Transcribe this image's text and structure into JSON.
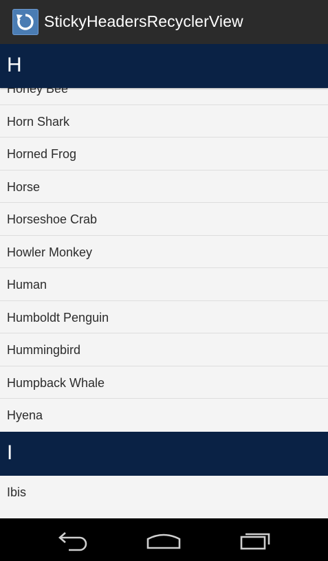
{
  "app": {
    "title": "StickyHeadersRecyclerView",
    "icon": "refresh-icon"
  },
  "sticky_header": {
    "letter": "H"
  },
  "sections": [
    {
      "letter": "H",
      "items": [
        "Honey Bee",
        "Horn Shark",
        "Horned Frog",
        "Horse",
        "Horseshoe Crab",
        "Howler Monkey",
        "Human",
        "Humboldt Penguin",
        "Hummingbird",
        "Humpback Whale",
        "Hyena"
      ]
    },
    {
      "letter": "I",
      "items": [
        "Ibis"
      ]
    }
  ],
  "nav": {
    "back_icon": "back-arrow-icon",
    "home_icon": "home-icon",
    "recents_icon": "recent-apps-icon"
  },
  "colors": {
    "header_bg": "#0a2245",
    "action_bar_bg": "#2b2b2b",
    "list_bg": "#f4f4f4",
    "divider": "#dddddd"
  }
}
